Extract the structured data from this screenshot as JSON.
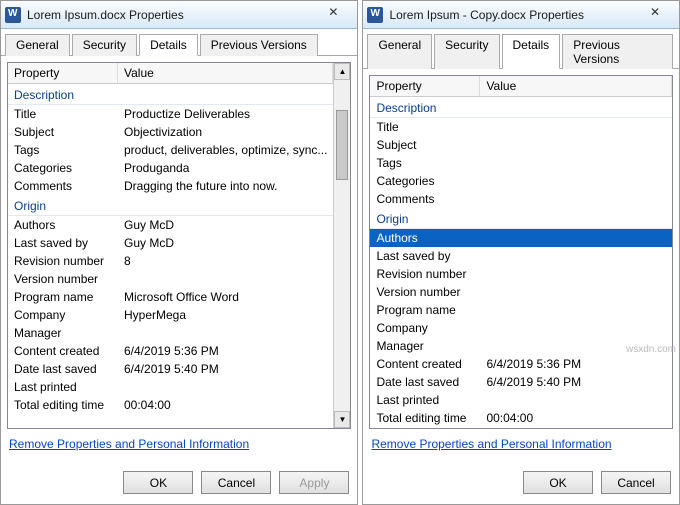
{
  "windows": [
    {
      "title": "Lorem Ipsum.docx Properties",
      "tabs": [
        "General",
        "Security",
        "Details",
        "Previous Versions"
      ],
      "activeTab": 2,
      "header": {
        "property": "Property",
        "value": "Value"
      },
      "sections": [
        {
          "name": "Description",
          "rows": [
            {
              "p": "Title",
              "v": "Productize Deliverables"
            },
            {
              "p": "Subject",
              "v": "Objectivization"
            },
            {
              "p": "Tags",
              "v": "product, deliverables, optimize, sync..."
            },
            {
              "p": "Categories",
              "v": "Produganda"
            },
            {
              "p": "Comments",
              "v": "Dragging the future into now."
            }
          ]
        },
        {
          "name": "Origin",
          "rows": [
            {
              "p": "Authors",
              "v": "Guy McD"
            },
            {
              "p": "Last saved by",
              "v": "Guy McD"
            },
            {
              "p": "Revision number",
              "v": "8"
            },
            {
              "p": "Version number",
              "v": ""
            },
            {
              "p": "Program name",
              "v": "Microsoft Office Word"
            },
            {
              "p": "Company",
              "v": "HyperMega"
            },
            {
              "p": "Manager",
              "v": ""
            },
            {
              "p": "Content created",
              "v": "6/4/2019 5:36 PM"
            },
            {
              "p": "Date last saved",
              "v": "6/4/2019 5:40 PM"
            },
            {
              "p": "Last printed",
              "v": ""
            },
            {
              "p": "Total editing time",
              "v": "00:04:00"
            }
          ]
        }
      ],
      "selectedRow": null,
      "removeLink": "Remove Properties and Personal Information",
      "buttons": {
        "ok": "OK",
        "cancel": "Cancel",
        "apply": "Apply"
      },
      "applyDisabled": true,
      "showScrollbar": true
    },
    {
      "title": "Lorem Ipsum - Copy.docx Properties",
      "tabs": [
        "General",
        "Security",
        "Details",
        "Previous Versions"
      ],
      "activeTab": 2,
      "header": {
        "property": "Property",
        "value": "Value"
      },
      "sections": [
        {
          "name": "Description",
          "rows": [
            {
              "p": "Title",
              "v": ""
            },
            {
              "p": "Subject",
              "v": ""
            },
            {
              "p": "Tags",
              "v": ""
            },
            {
              "p": "Categories",
              "v": ""
            },
            {
              "p": "Comments",
              "v": ""
            }
          ]
        },
        {
          "name": "Origin",
          "rows": [
            {
              "p": "Authors",
              "v": "",
              "selected": true
            },
            {
              "p": "Last saved by",
              "v": ""
            },
            {
              "p": "Revision number",
              "v": ""
            },
            {
              "p": "Version number",
              "v": ""
            },
            {
              "p": "Program name",
              "v": ""
            },
            {
              "p": "Company",
              "v": ""
            },
            {
              "p": "Manager",
              "v": ""
            },
            {
              "p": "Content created",
              "v": "6/4/2019 5:36 PM"
            },
            {
              "p": "Date last saved",
              "v": "6/4/2019 5:40 PM"
            },
            {
              "p": "Last printed",
              "v": ""
            },
            {
              "p": "Total editing time",
              "v": "00:04:00"
            }
          ]
        }
      ],
      "removeLink": "Remove Properties and Personal Information",
      "buttons": {
        "ok": "OK",
        "cancel": "Cancel"
      },
      "applyDisabled": false,
      "showScrollbar": false
    }
  ],
  "watermark": "wsxdn.com"
}
